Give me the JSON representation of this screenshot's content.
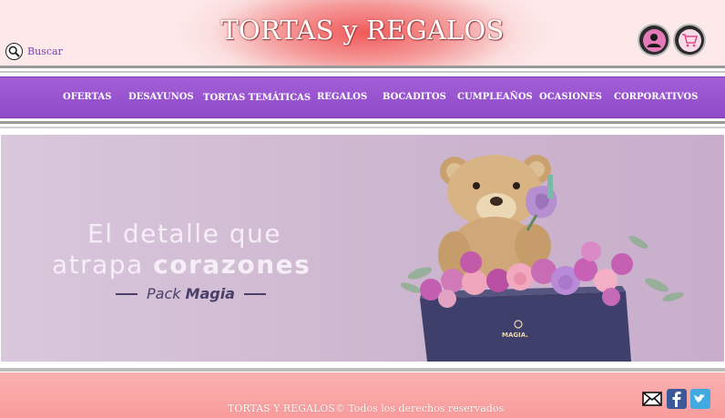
{
  "header": {
    "title": "TORTAS y REGALOS",
    "search_label": "Buscar",
    "user_icon": "user-icon",
    "cart_icon": "cart-icon"
  },
  "nav": {
    "items": [
      {
        "label": "OFERTAS"
      },
      {
        "label": "DESAYUNOS"
      },
      {
        "label": "TORTAS TEMÁTICAS"
      },
      {
        "label": "REGALOS"
      },
      {
        "label": "BOCADITOS"
      },
      {
        "label": "CUMPLEAÑOS"
      },
      {
        "label": "OCASIONES"
      },
      {
        "label": "CORPORATIVOS"
      }
    ]
  },
  "banner": {
    "line1": "El detalle que",
    "line2_prefix": "atrapa ",
    "line2_bold": "corazones",
    "pack_prefix": "Pack",
    "pack_name": "Magia",
    "box_brand": "MAGIA."
  },
  "footer": {
    "copyright": "TORTAS Y REGALOS© Todos los derechos reservados",
    "social": [
      "mail-icon",
      "facebook-icon",
      "twitter-icon"
    ]
  },
  "colors": {
    "nav_purple": "#9a55d0",
    "header_red": "#f15a5a",
    "footer_pink": "#fbaaaa",
    "link_purple": "#7a3fb3"
  }
}
